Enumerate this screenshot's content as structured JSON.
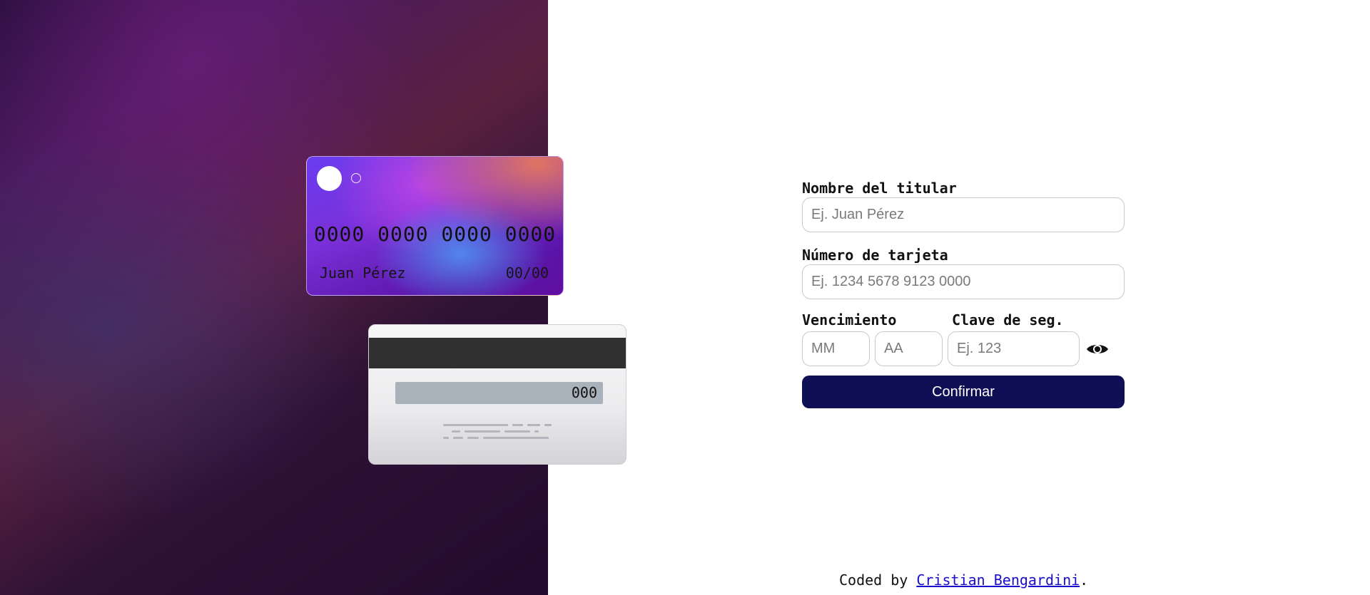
{
  "card_front": {
    "number": "0000 0000 0000 0000",
    "holder_name": "Juan Pérez",
    "expiry": "00/00"
  },
  "card_back": {
    "cvv": "000"
  },
  "form": {
    "holder_label": "Nombre del titular",
    "holder_placeholder": "Ej. Juan Pérez",
    "number_label": "Número de tarjeta",
    "number_placeholder": "Ej. 1234 5678 9123 0000",
    "expiry_label": "Vencimiento",
    "cvv_label": "Clave de seg.",
    "month_placeholder": "MM",
    "year_placeholder": "AA",
    "cvv_placeholder": "Ej. 123",
    "toggle_icon": "eye-icon",
    "confirm_label": "Confirmar"
  },
  "footer": {
    "prefix": "Coded by ",
    "author": "Cristian Bengardini",
    "suffix": "."
  },
  "colors": {
    "confirm_button": "#0e0f54",
    "link": "#1a0dcc",
    "card_stripe": "#303030"
  }
}
